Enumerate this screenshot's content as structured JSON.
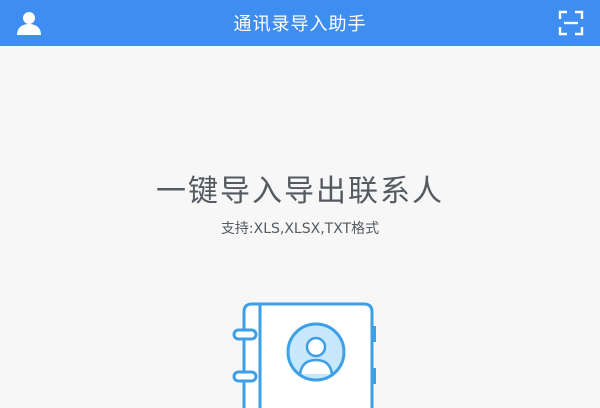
{
  "app_bar": {
    "title": "通讯录导入助手",
    "left_icon": "user-icon",
    "right_icon": "scan-icon",
    "color": "#3d8ef0"
  },
  "main": {
    "headline": "一键导入导出联系人",
    "subline": "支持:XLS,XLSX,TXT格式",
    "illustration_icon": "contact-book-icon",
    "accent_color": "#3d9fe6",
    "accent_fill": "#c7e7fb"
  }
}
